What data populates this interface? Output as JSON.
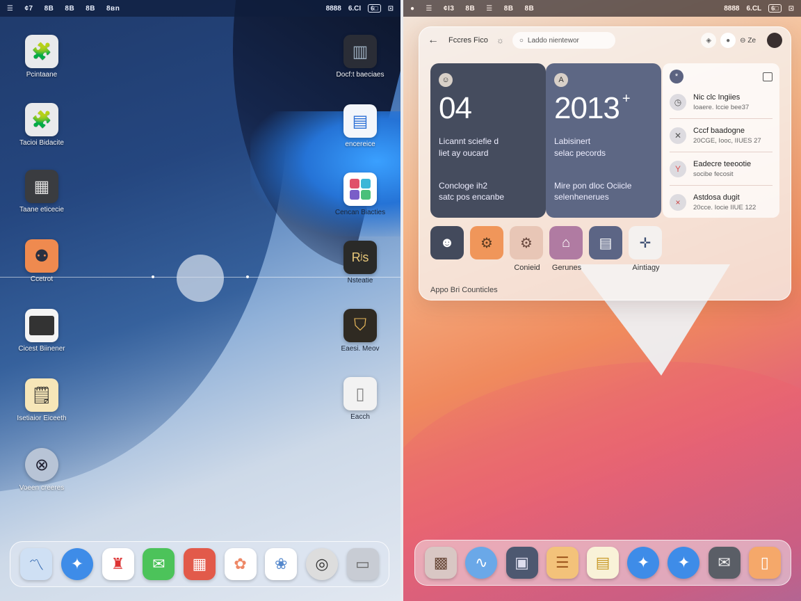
{
  "left": {
    "status": {
      "menu_glyph": "☰",
      "items": [
        "¢7",
        "8B",
        "8B",
        "8B",
        "8B",
        "8B"
      ],
      "last_item": "8ʙn",
      "right_time": "8888",
      "right_sig": "6.CI",
      "right_box": "6□",
      "right_end": "⊡"
    },
    "desktop_icons": [
      {
        "label": "Pcintaane",
        "icon": "puzzle-icon"
      },
      {
        "label": "Tacioi Bidacite",
        "icon": "puzzle-icon"
      },
      {
        "label": "Taane eticecie",
        "icon": "calculator-icon"
      },
      {
        "label": "Ccetrot",
        "icon": "keypad-icon"
      },
      {
        "label": "Cicest Biinener",
        "icon": "monitor-icon"
      },
      {
        "label": "Isetiaior Eiceeth",
        "icon": "notes-icon"
      },
      {
        "label": "Voeen creeres",
        "icon": "wheel-icon"
      }
    ],
    "desktop_icons_right": [
      {
        "label": "Docf:t baeciaes",
        "icon": "grid-icon"
      },
      {
        "label": "encereice",
        "icon": "window-icon"
      },
      {
        "label": "Cencan Biacties",
        "icon": "color-tiles-icon"
      },
      {
        "label": "Nsteatie",
        "icon": "rijs-icon"
      },
      {
        "label": "Eaesi. Meov",
        "icon": "mask-icon"
      },
      {
        "label": "Eacch",
        "icon": "book-icon"
      }
    ],
    "dock": [
      "chart-icon",
      "safari-icon",
      "mario-icon",
      "messages-icon",
      "calendar-icon",
      "photos-icon",
      "photos-icon",
      "disc-icon",
      "drive-icon"
    ]
  },
  "right": {
    "status": {
      "dot": "●",
      "menu_glyph": "☰",
      "items": [
        "¢I3",
        "8B",
        "☰",
        "8B",
        "8B"
      ],
      "right_time": "8888",
      "right_sig": "6.CL",
      "right_box": "6□",
      "right_end": "⊡"
    },
    "card": {
      "title": "Fccres Fico",
      "search_placeholder": "Laddo nientewor",
      "zoom": "⊖ Ze",
      "tile1": {
        "badge": "☺",
        "big": "04",
        "sub1": "Licannt sciefie d",
        "sub2": "liet ay oucard",
        "foot1": "Concloge ih2",
        "foot2": "satc pos encanbe"
      },
      "tile2": {
        "badge": "A",
        "big": "2013",
        "plus": "+",
        "sub1": "Labisinert",
        "sub2": "selac pecords",
        "foot1": "Mire pon dloc Ociicle",
        "foot2": "selenhenerues"
      },
      "list": [
        {
          "icon": "clock-icon",
          "title": "Nic clc Ingiies",
          "sub": "Ioaere. lccie bee37"
        },
        {
          "icon": "cross-icon",
          "title": "Cccf baadogne",
          "sub": "20CGE, Iooc, IIUES 27"
        },
        {
          "icon": "arrow-icon",
          "title": "Eadecre teeootie",
          "sub": "socibe fecosit"
        },
        {
          "icon": "close-icon",
          "title": "Astdosa dugit",
          "sub": "20cce. Iocie IIUE 122"
        }
      ],
      "apps": [
        {
          "label": "",
          "color": "#434a5c",
          "icon": "face-icon"
        },
        {
          "label": "",
          "color": "#f0965a",
          "icon": "gears-icon"
        },
        {
          "label": "Conieid",
          "color": "#e8c6b6",
          "icon": "gears-icon"
        },
        {
          "label": "Gerunes",
          "color": "#b07ba2",
          "icon": "frame-icon"
        },
        {
          "label": "",
          "color": "#5c6585",
          "icon": "doc-icon"
        },
        {
          "label": "Aintiagy",
          "color": "#f4f1ef",
          "icon": "pin-icon"
        }
      ],
      "footer": "Appo Bri Counticles"
    },
    "dock": [
      "apps-icon",
      "wave-icon",
      "calc-icon",
      "list-icon",
      "notes-icon",
      "safari-icon",
      "safari-icon",
      "mail-icon",
      "phone-icon"
    ]
  }
}
